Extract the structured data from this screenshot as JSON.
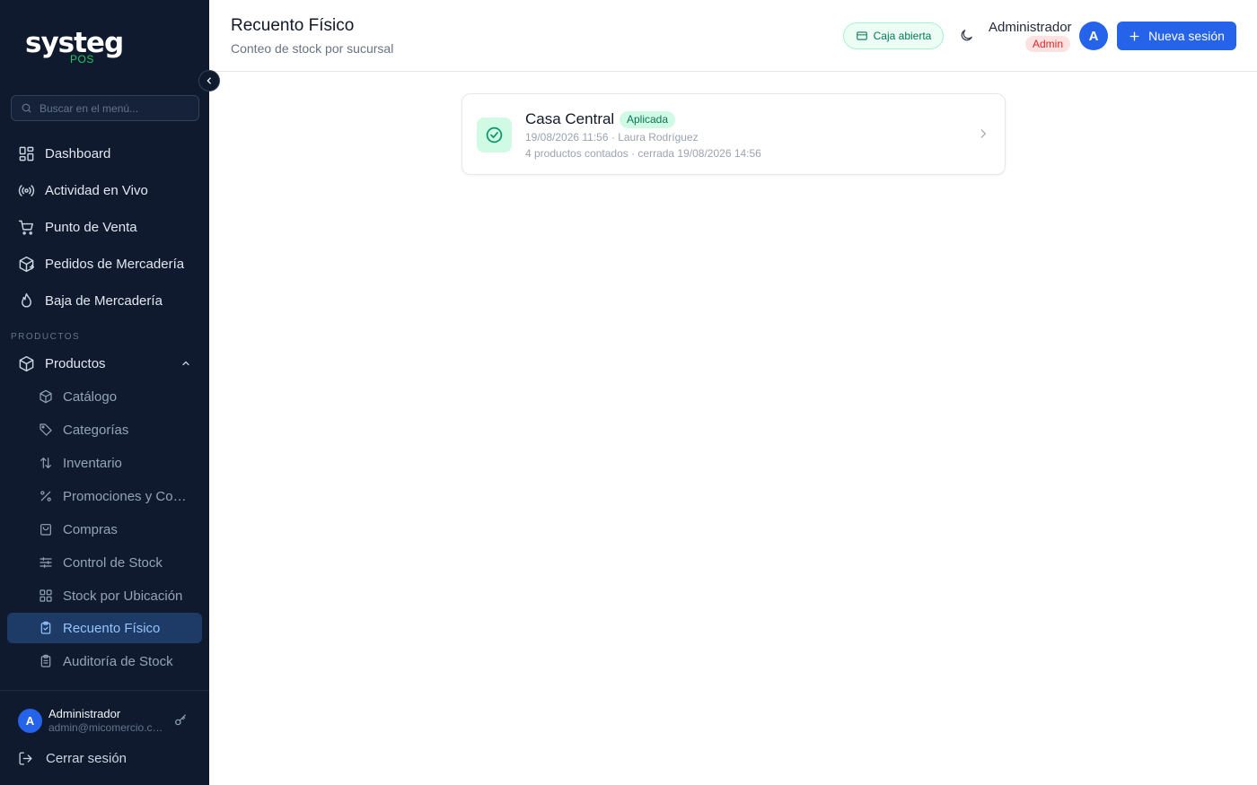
{
  "app": {
    "logo_text": "systeg",
    "logo_sub": "POS"
  },
  "sidebar": {
    "search_placeholder": "Buscar en el menú...",
    "items": [
      {
        "label": "Dashboard",
        "icon": "dashboard-icon"
      },
      {
        "label": "Actividad en Vivo",
        "icon": "broadcast-icon"
      },
      {
        "label": "Punto de Venta",
        "icon": "cart-icon"
      },
      {
        "label": "Pedidos de Mercadería",
        "icon": "package-plus-icon"
      },
      {
        "label": "Baja de Mercadería",
        "icon": "flame-icon"
      }
    ],
    "section_label": "PRODUCTOS",
    "group": {
      "label": "Productos",
      "icon": "box-icon",
      "expanded": true
    },
    "sub_items": [
      {
        "label": "Catálogo",
        "icon": "box-icon"
      },
      {
        "label": "Categorías",
        "icon": "tag-icon"
      },
      {
        "label": "Inventario",
        "icon": "arrows-up-down-icon"
      },
      {
        "label": "Promociones y Combos",
        "icon": "percent-icon"
      },
      {
        "label": "Compras",
        "icon": "shopping-bag-icon"
      },
      {
        "label": "Control de Stock",
        "icon": "sliders-icon"
      },
      {
        "label": "Stock por Ubicación",
        "icon": "grid-icon"
      },
      {
        "label": "Recuento Físico",
        "icon": "clipboard-check-icon",
        "active": true
      },
      {
        "label": "Auditoría de Stock",
        "icon": "clipboard-list-icon"
      }
    ],
    "user": {
      "initial": "A",
      "name": "Administrador",
      "email": "admin@micomercio.com"
    },
    "logout_label": "Cerrar sesión"
  },
  "header": {
    "title": "Recuento Físico",
    "subtitle": "Conteo de stock por sucursal",
    "caja_label": "Caja abierta",
    "user_name": "Administrador",
    "user_role": "Admin",
    "user_initial": "A",
    "new_button_label": "Nueva sesión"
  },
  "sessions": [
    {
      "branch": "Casa Central",
      "status": "Aplicada",
      "meta_line1": "19/08/2026 11:56 · Laura Rodríguez",
      "meta_line2": "4 productos contados · cerrada 19/08/2026 14:56"
    }
  ],
  "colors": {
    "sidebar_bg": "#0f1a2e",
    "accent": "#2563eb",
    "success": "#047857",
    "success_bg": "#d1fae5",
    "danger": "#dc2626",
    "danger_bg": "#fee2e2"
  }
}
